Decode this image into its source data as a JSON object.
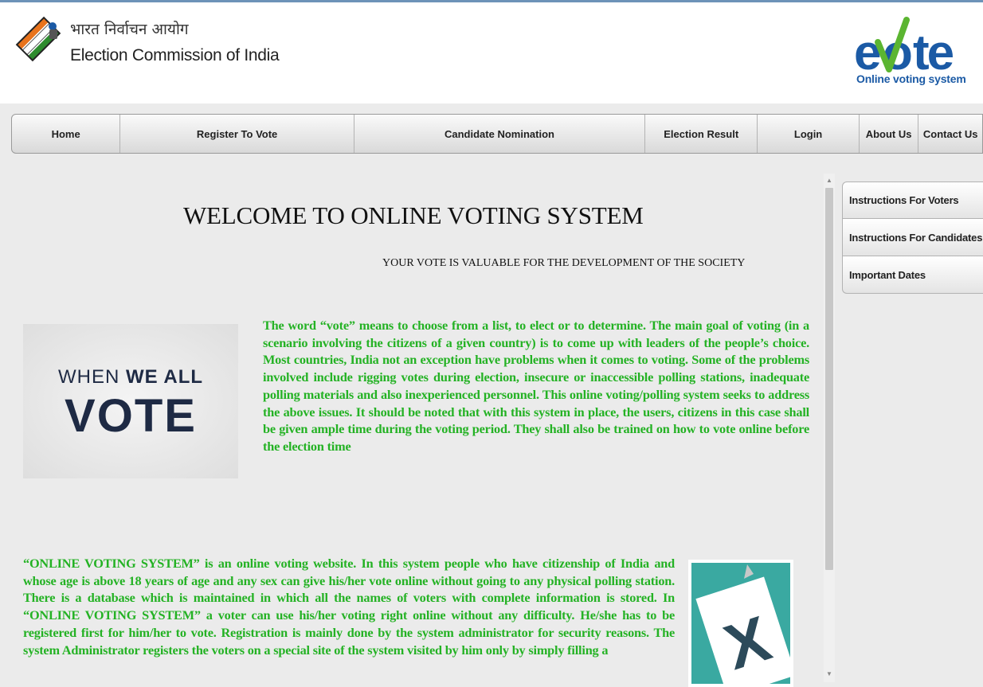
{
  "header": {
    "org_hindi": "भारत निर्वाचन आयोग",
    "org_english": "Election Commission of India",
    "logo_text": "evote",
    "logo_subtitle": "Online voting system"
  },
  "nav": {
    "items": [
      {
        "label": "Home"
      },
      {
        "label": "Register To Vote"
      },
      {
        "label": "Candidate Nomination"
      },
      {
        "label": "Election Result"
      },
      {
        "label": "Login"
      },
      {
        "label": "About Us"
      },
      {
        "label": "Contact Us"
      }
    ]
  },
  "main": {
    "title": "WELCOME TO ONLINE VOTING SYSTEM",
    "tagline": "YOUR VOTE IS VALUABLE FOR THE DEVELOPMENT OF THE SOCIETY",
    "image1": {
      "line1_pre": "WHEN ",
      "line1_bold": "WE ALL",
      "line2": "VOTE"
    },
    "para1": "The word “vote” means to choose from a list, to elect or to determine. The main goal of voting (in a scenario involving the citizens of a given country) is to come up with leaders of the people’s choice. Most countries, India not an exception have problems when it comes to voting. Some of the problems involved include rigging votes during election, insecure or inaccessible polling stations, inadequate polling materials and also inexperienced personnel. This online voting/polling system seeks to address the above issues. It should be noted that with this system in place, the users, citizens in this case shall be given ample time during the voting period. They shall also be trained on how to vote online before the election time",
    "para2": "“ONLINE VOTING SYSTEM” is an online voting website. In this system people who have citizenship of India and whose age is above 18 years of age and any sex can give his/her vote online without going to any physical polling station. There is a database which is maintained in which all the names of voters with complete information is stored. In “ONLINE VOTING SYSTEM” a voter can use his/her voting right online without any difficulty. He/she has to be registered first for him/her to vote. Registration is mainly done by the system administrator for security reasons. The system Administrator registers the voters on a special site of the system visited by him only by simply filling a",
    "image2": {
      "mark": "X"
    }
  },
  "sidebar": {
    "items": [
      {
        "label": "Instructions For Voters"
      },
      {
        "label": "Instructions For Candidates"
      },
      {
        "label": "Important Dates"
      }
    ]
  },
  "colors": {
    "green_text": "#24b224",
    "evote_blue": "#1b5aa5",
    "evote_green": "#5bb531",
    "teal": "#3aa9a1"
  }
}
